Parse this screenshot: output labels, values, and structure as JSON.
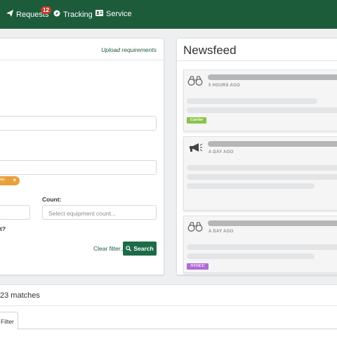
{
  "nav": {
    "requests_label": "Requests",
    "requests_badge": "12",
    "tracking_label": "Tracking",
    "service_label": "Service"
  },
  "search_panel": {
    "upload_link": "Upload requirements",
    "tag_text": "au",
    "tag_close": "×",
    "count_label": "Count:",
    "count_placeholder": "Select equipment count...",
    "question_fragment": "t?",
    "clear_filter": "Clear filter...",
    "search_button": "Search"
  },
  "newsfeed": {
    "title": "Newsfeed",
    "cards": [
      {
        "icon": "binoculars-icon",
        "time": "5 HOURS AGO",
        "category": "Carrier",
        "category_color": "#8bc34a"
      },
      {
        "icon": "megaphone-icon",
        "time": "A DAY AGO"
      },
      {
        "icon": "binoculars-icon",
        "time": "A DAY AGO",
        "category": "NVOCC",
        "category_color": "#b06ad8"
      }
    ]
  },
  "results": {
    "matches": "23 matches",
    "filter_tab": "Filter"
  },
  "colors": {
    "brand": "#1d5c3b",
    "badge": "#c0392b",
    "tag": "#e8a13a"
  }
}
